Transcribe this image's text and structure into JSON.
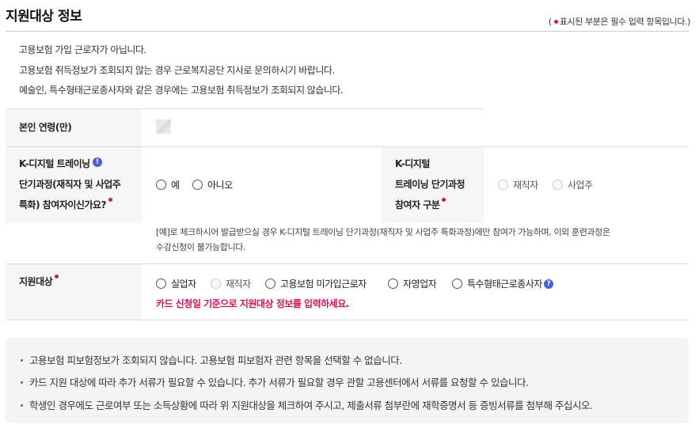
{
  "title": "지원대상 정보",
  "required_note": {
    "open": "(",
    "text": "표시된 부분은 필수 입력 항목입니다.)"
  },
  "notices": [
    "고용보험 가입 근로자가 아닙니다.",
    "고용보험 취득정보가 조회되지 않는 경우 근로복지공단 지사로 문의하시기 바랍니다.",
    "예술인, 특수형태근로종사자와 같은 경우에는 고용보험 취득정보가 조회되지 않습니다."
  ],
  "age": {
    "label": "본인 연령(만)"
  },
  "kdigital": {
    "label_lines": [
      "K-디지털 트레이닝",
      "단기과정(재직자 및 사업주",
      "특화) 참여자이신가요?"
    ],
    "info_icon": "info-icon",
    "options": [
      "예",
      "아니오"
    ],
    "type_label_lines": [
      "K-디지털",
      "트레이닝 단기과정",
      "참여자 구분"
    ],
    "type_options": [
      "재직자",
      "사업주"
    ],
    "hint_lines": [
      "[예]로 체크하시어 발급받으실 경우 K-디지털 트레이닝 단기과정(재직자 및 사업주 특화과정)에만 참여가 가능하며, 이외 훈련과정은",
      "수강신청이 불가능합니다."
    ]
  },
  "target": {
    "label": "지원대상",
    "options": [
      {
        "label": "실업자",
        "disabled": false
      },
      {
        "label": "재직자",
        "disabled": true
      },
      {
        "label": "고용보험 미가입근로자",
        "disabled": false
      },
      {
        "label": "자영업자",
        "disabled": false
      },
      {
        "label": "특수형태근로종사자",
        "disabled": false
      }
    ],
    "help_icon": "question-icon",
    "warning": "카드 신청일 기준으로 지원대상 정보를 입력하세요."
  },
  "info_box": [
    "고용보험 피보험정보가 조회되지 않습니다. 고용보험 피보험자 관련 항목을 선택할 수 없습니다.",
    "카드 지원 대상에 따라 추가 서류가 필요할 수 있습니다. 추가 서류가 필요할 경우 관할 고용센터에서 서류를 요청할 수 있습니다.",
    "학생인 경우에도 근로여부 또는 소득상황에 따라 위 지원대상을 체크하여 주시고, 제출서류 첨부란에 재학증명서 등 증빙서류를 첨부해 주십시오."
  ],
  "colors": {
    "required_dot": "#d4145a",
    "warning_text": "#d4145a",
    "info_icon": "#4a5fe0",
    "label_bg": "#f6f6f6"
  }
}
